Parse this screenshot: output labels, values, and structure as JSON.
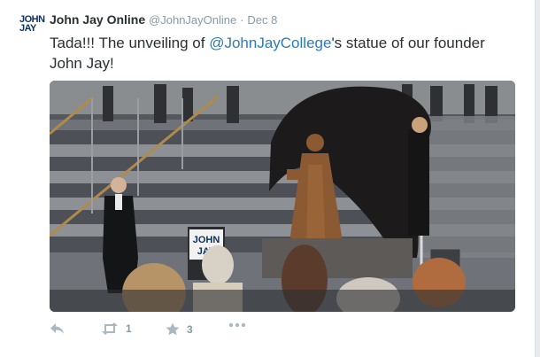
{
  "tweet": {
    "avatar_line1": "JOHN",
    "avatar_line2": "JAY",
    "author_name": "John Jay Online",
    "handle": "@JohnJayOnline",
    "separator": "·",
    "date": "Dec 8",
    "text_before": "Tada!!! The unveiling of ",
    "mention": "@JohnJayCollege",
    "text_after": "'s statue of our founder John Jay!"
  },
  "media": {
    "podium_sign_line1": "JOHN",
    "podium_sign_line2": "JAY"
  },
  "actions": {
    "reply_icon": "reply-icon",
    "retweet_icon": "retweet-icon",
    "retweet_count": "1",
    "favorite_icon": "star-icon",
    "favorite_count": "3",
    "more_icon": "more-icon"
  },
  "colors": {
    "link": "#2b7bb9",
    "muted": "#8899a6",
    "text": "#292f33",
    "brand_navy": "#0d2f5e"
  }
}
